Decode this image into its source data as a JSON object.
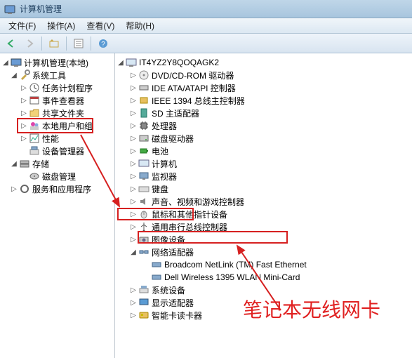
{
  "window": {
    "title": "计算机管理"
  },
  "menu": {
    "file": "文件(F)",
    "action": "操作(A)",
    "view": "查看(V)",
    "help": "帮助(H)"
  },
  "left_tree": {
    "root": "计算机管理(本地)",
    "system_tools": "系统工具",
    "task_scheduler": "任务计划程序",
    "event_viewer": "事件查看器",
    "shared_folders": "共享文件夹",
    "local_users": "本地用户和组",
    "performance": "性能",
    "device_manager": "设备管理器",
    "storage": "存储",
    "disk_mgmt": "磁盘管理",
    "services_apps": "服务和应用程序"
  },
  "right_tree": {
    "computer": "IT4YZ2Y8QOQAGK2",
    "dvd": "DVD/CD-ROM 驱动器",
    "ide": "IDE ATA/ATAPI 控制器",
    "ieee1394": "IEEE 1394 总线主控制器",
    "sd": "SD 主适配器",
    "cpu": "处理器",
    "disk": "磁盘驱动器",
    "battery": "电池",
    "computer_node": "计算机",
    "monitor": "监视器",
    "keyboard": "键盘",
    "sound": "声音、视频和游戏控制器",
    "mouse": "鼠标和其他指针设备",
    "usb": "通用串行总线控制器",
    "imaging": "图像设备",
    "network": "网络适配器",
    "nic1": "Broadcom NetLink (TM) Fast Ethernet",
    "nic2": "Dell Wireless 1395 WLAN Mini-Card",
    "system_devices": "系统设备",
    "display": "显示适配器",
    "smartcard": "智能卡读卡器"
  },
  "annotation": {
    "text": "笔记本无线网卡"
  }
}
